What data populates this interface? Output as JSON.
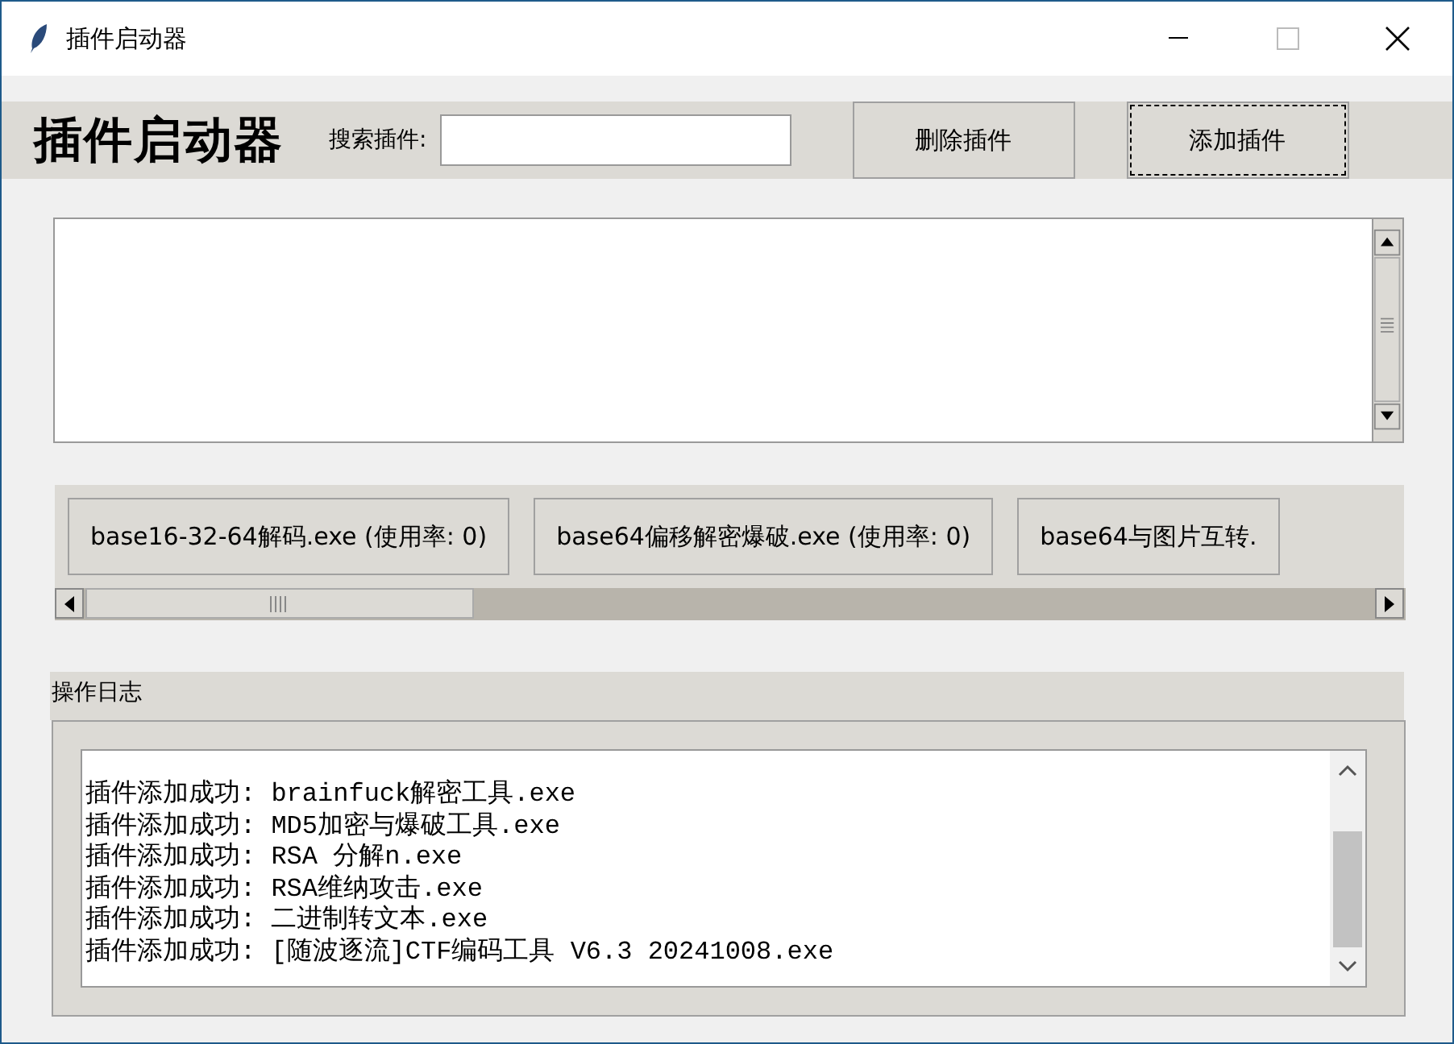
{
  "window": {
    "title": "插件启动器"
  },
  "header": {
    "title": "插件启动器",
    "search_label": "搜索插件:",
    "buttons": [
      {
        "label": "删除插件",
        "focused": false
      },
      {
        "label": "添加插件",
        "focused": true
      }
    ]
  },
  "plugins": [
    {
      "label": "base16-32-64解码.exe (使用率: 0)"
    },
    {
      "label": "base64偏移解密爆破.exe (使用率: 0)"
    },
    {
      "label": "base64与图片互转."
    }
  ],
  "log": {
    "title": "操作日志",
    "lines": [
      "插件添加成功: brainfuck解密工具.exe",
      "插件添加成功: MD5加密与爆破工具.exe",
      "插件添加成功: RSA 分解n.exe",
      "插件添加成功: RSA维纳攻击.exe",
      "插件添加成功: 二进制转文本.exe",
      "插件添加成功: [随波逐流]CTF编码工具 V6.3 20241008.exe"
    ]
  }
}
